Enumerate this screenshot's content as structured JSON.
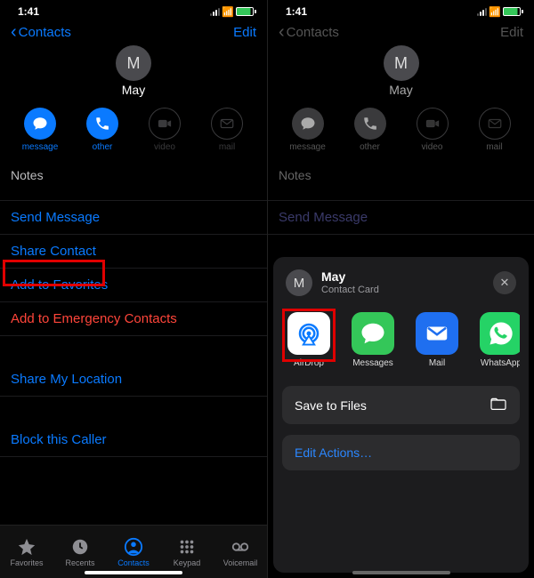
{
  "status": {
    "time": "1:41"
  },
  "nav": {
    "back": "Contacts",
    "edit": "Edit"
  },
  "contact": {
    "initial": "M",
    "name": "May"
  },
  "actions": {
    "message": "message",
    "other": "other",
    "video": "video",
    "mail": "mail"
  },
  "rows": {
    "notes": "Notes",
    "send_message": "Send Message",
    "share_contact": "Share Contact",
    "add_favorites": "Add to Favorites",
    "add_emergency": "Add to Emergency Contacts",
    "share_location": "Share My Location",
    "block": "Block this Caller"
  },
  "tabs": {
    "favorites": "Favorites",
    "recents": "Recents",
    "contacts": "Contacts",
    "keypad": "Keypad",
    "voicemail": "Voicemail"
  },
  "sheet": {
    "title": "May",
    "subtitle": "Contact Card",
    "apps": {
      "airdrop": "AirDrop",
      "messages": "Messages",
      "mail": "Mail",
      "whatsapp": "WhatsApp"
    },
    "save_files": "Save to Files",
    "edit_actions": "Edit Actions…"
  }
}
